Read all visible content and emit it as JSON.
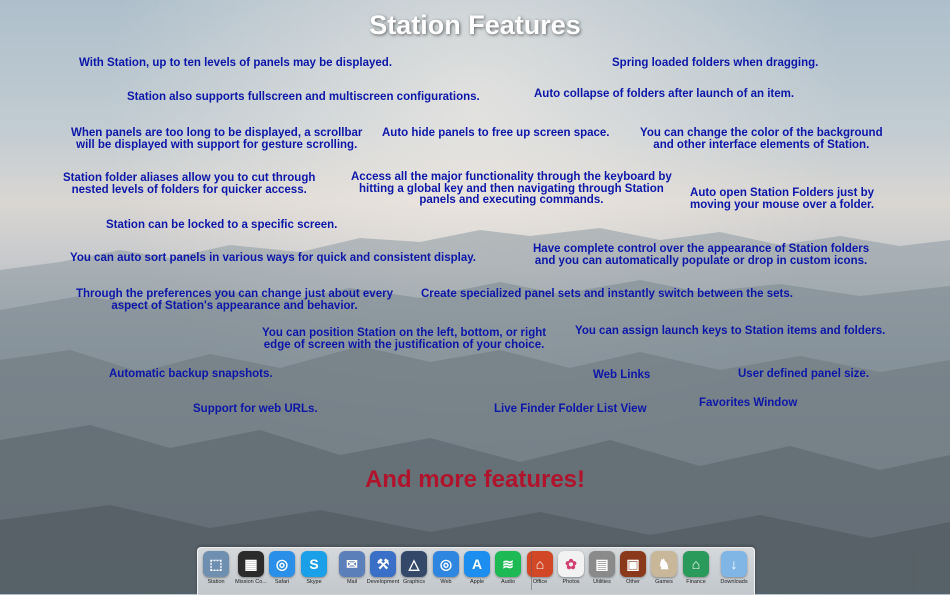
{
  "title": "Station Features",
  "features": [
    "With Station, up to ten levels of panels may be displayed.",
    "Spring loaded folders when dragging.",
    "Station also supports fullscreen and multiscreen configurations.",
    "Auto collapse of folders after launch of an item.",
    "When panels are too long to be displayed, a scrollbar\nwill be displayed with support for gesture scrolling.",
    "Auto hide panels to free up screen space.",
    "You can change the color of the background\nand other interface elements of Station.",
    "Station folder aliases allow you to cut through\nnested levels of folders for quicker access.",
    "Access all the major functionality through the keyboard by\nhitting a global key and then navigating through Station\npanels and executing commands.",
    "Auto open Station Folders just by\nmoving your mouse over a folder.",
    "Station can be locked to a specific screen.",
    "You can auto sort panels in various ways for quick and consistent display.",
    "Have complete control over the appearance of Station folders\nand you can automatically populate or drop in custom icons.",
    "Through the preferences you can change just about every\naspect of Station's appearance and behavior.",
    "Create specialized panel sets and instantly switch between the sets.",
    "You can position Station on the left, bottom, or right\nedge of screen with the justification of your choice.",
    "You can assign launch keys to Station items and folders.",
    "Automatic backup snapshots.",
    "Web Links",
    "User defined panel size.",
    "Support for web URLs.",
    "Live Finder Folder List View",
    "Favorites Window"
  ],
  "more": "And more features!",
  "dock": [
    {
      "label": "Station",
      "icon": "station-icon",
      "color": "#6f8fb0",
      "glyph": "⬚"
    },
    {
      "label": "Mission Co...",
      "icon": "mission-control-icon",
      "color": "#2b2b2b",
      "glyph": "▦"
    },
    {
      "label": "Safari",
      "icon": "safari-icon",
      "color": "#2a8fe8",
      "glyph": "◎"
    },
    {
      "label": "Skype",
      "icon": "skype-icon",
      "color": "#1aa0e8",
      "glyph": "S"
    },
    {
      "label": "Mail",
      "icon": "mail-icon",
      "color": "#5b7fb8",
      "glyph": "✉"
    },
    {
      "label": "Development",
      "icon": "development-icon",
      "color": "#3a6fc8",
      "glyph": "⚒"
    },
    {
      "label": "Graphics",
      "icon": "graphics-icon",
      "color": "#34496a",
      "glyph": "△"
    },
    {
      "label": "Web",
      "icon": "web-icon",
      "color": "#2e86e0",
      "glyph": "◎"
    },
    {
      "label": "Apple",
      "icon": "app-store-icon",
      "color": "#1c8ef0",
      "glyph": "A"
    },
    {
      "label": "Audio",
      "icon": "spotify-icon",
      "color": "#1db954",
      "glyph": "≋"
    },
    {
      "label": "Office",
      "icon": "office-icon",
      "color": "#d24726",
      "glyph": "⌂"
    },
    {
      "label": "Photos",
      "icon": "photos-icon",
      "color": "#f2f2f2",
      "glyph": "✿"
    },
    {
      "label": "Utilities",
      "icon": "utilities-icon",
      "color": "#8a8a8a",
      "glyph": "▤"
    },
    {
      "label": "Other",
      "icon": "other-icon",
      "color": "#8a3a1a",
      "glyph": "▣"
    },
    {
      "label": "Games",
      "icon": "games-icon",
      "color": "#c9b79a",
      "glyph": "♞"
    },
    {
      "label": "Finance",
      "icon": "finance-icon",
      "color": "#2a9a5a",
      "glyph": "⌂"
    },
    {
      "label": "Downloads",
      "icon": "downloads-folder-icon",
      "color": "#7fb6e6",
      "glyph": "↓"
    }
  ]
}
